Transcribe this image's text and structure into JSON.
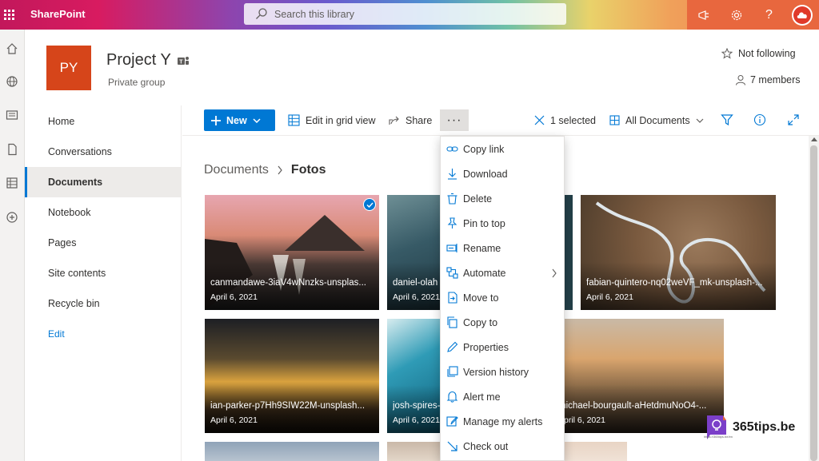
{
  "suitebar": {
    "app_name": "SharePoint",
    "search_placeholder": "Search this library"
  },
  "site": {
    "logo_initials": "PY",
    "title": "Project Y",
    "subtitle": "Private group",
    "follow_label": "Not following",
    "members_label": "7 members"
  },
  "nav": {
    "items": [
      {
        "label": "Home"
      },
      {
        "label": "Conversations"
      },
      {
        "label": "Documents",
        "selected": true
      },
      {
        "label": "Notebook"
      },
      {
        "label": "Pages"
      },
      {
        "label": "Site contents"
      },
      {
        "label": "Recycle bin"
      },
      {
        "label": "Edit"
      }
    ]
  },
  "commandbar": {
    "new_label": "New",
    "edit_grid_label": "Edit in grid view",
    "share_label": "Share",
    "more_label": "···",
    "selected_label": "1 selected",
    "view_label": "All Documents"
  },
  "breadcrumb": {
    "parent": "Documents",
    "current": "Fotos"
  },
  "tiles": [
    {
      "name": "canmandawe-3iaV4wNnzks-unsplas...",
      "date": "April 6, 2021",
      "selected": true
    },
    {
      "name": "daniel-olah",
      "date": "April 6, 2021"
    },
    {
      "name": "fabian-quintero-nq02weVF_mk-unsplash-...",
      "date": "April 6, 2021"
    },
    {
      "name": "ian-parker-p7Hh9SIW22M-unsplash...",
      "date": "April 6, 2021"
    },
    {
      "name": "josh-spires-",
      "date": "April 6, 2021"
    },
    {
      "name": "michael-bourgault-aHetdmuNoO4-...",
      "date": "April 6, 2021"
    }
  ],
  "context_menu": {
    "items": [
      {
        "label": "Copy link",
        "icon": "link-icon"
      },
      {
        "label": "Download",
        "icon": "download-icon"
      },
      {
        "label": "Delete",
        "icon": "delete-icon"
      },
      {
        "label": "Pin to top",
        "icon": "pin-icon"
      },
      {
        "label": "Rename",
        "icon": "rename-icon"
      },
      {
        "label": "Automate",
        "icon": "automate-icon",
        "submenu": true
      },
      {
        "label": "Move to",
        "icon": "move-icon"
      },
      {
        "label": "Copy to",
        "icon": "copy-icon"
      },
      {
        "label": "Properties",
        "icon": "edit-icon"
      },
      {
        "label": "Version history",
        "icon": "history-icon"
      },
      {
        "label": "Alert me",
        "icon": "bell-icon"
      },
      {
        "label": "Manage my alerts",
        "icon": "manage-alerts-icon"
      },
      {
        "label": "Check out",
        "icon": "checkout-icon"
      }
    ]
  },
  "watermark": {
    "brand": "365tips.be",
    "tagline": "https://365tips.be/en"
  },
  "colors": {
    "accent": "#0078d4",
    "site_logo": "#d6451a",
    "suitebar_right": "#e8673e"
  }
}
